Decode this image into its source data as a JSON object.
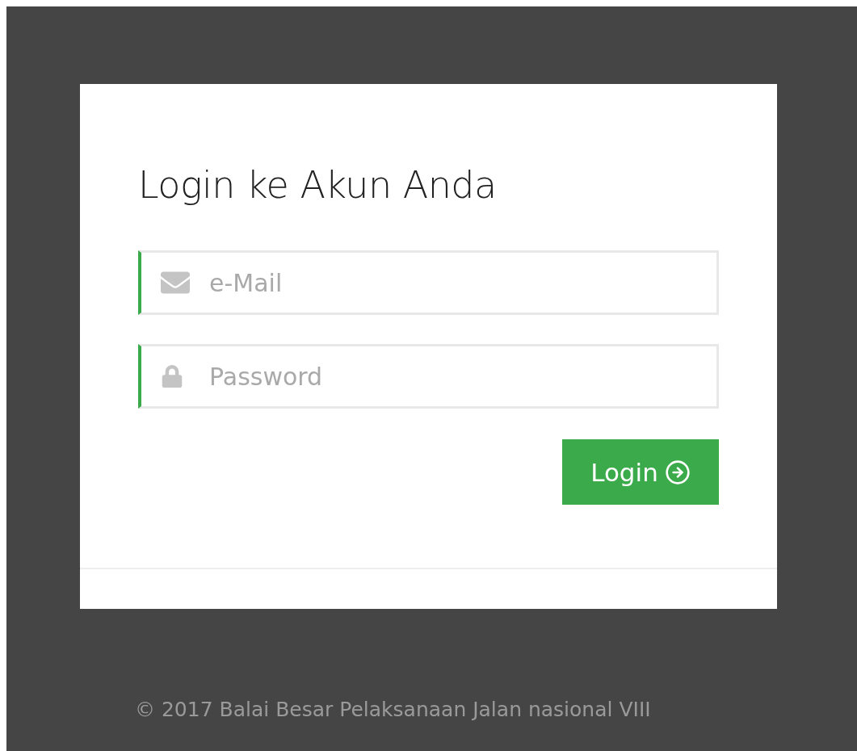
{
  "login_card": {
    "title": "Login ke Akun Anda",
    "fields": [
      {
        "kind": "email",
        "placeholder": "e-Mail"
      },
      {
        "kind": "password",
        "placeholder": "Password"
      }
    ],
    "button": {
      "label": "Login"
    }
  },
  "footer": {
    "text": "© 2017 Balai Besar Pelaksanaan Jalan nasional VIII"
  }
}
